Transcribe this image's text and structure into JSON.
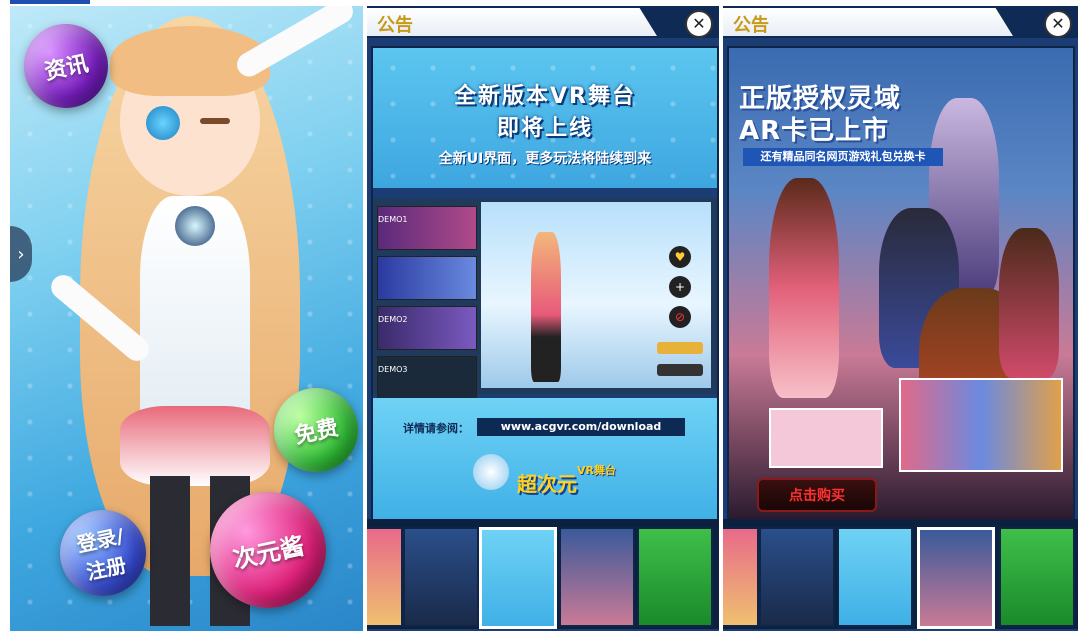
{
  "panel1": {
    "bubbles": {
      "news": "资讯",
      "free": "免费",
      "login_line1": "登录/",
      "login_line2": "注册",
      "ciyuanjiang": "次元酱"
    },
    "nav_arrow_icon": "chevron-right-icon"
  },
  "panel2": {
    "header_title": "公告",
    "close_icon": "close-icon",
    "headline_line1": "全新版本VR舞台",
    "headline_line2": "即将上线",
    "subline": "全新UI界面，更多玩法将陆续到来",
    "details_label": "详情请参阅：",
    "url": "www.acgvr.com/download",
    "logo_text_main": "超次元",
    "logo_text_sub": "VR舞台",
    "app_song_labels": [
      "DEMO1",
      "DEMO2",
      "DEMO3"
    ]
  },
  "panel3": {
    "header_title": "公告",
    "close_icon": "close-icon",
    "headline_line1": "正版授权灵域",
    "headline_line2": "AR卡已上市",
    "subline": "还有精品同名网页游戏礼包兑换卡",
    "buy_button": "点击购买"
  },
  "colors": {
    "header_gold": "#c79a1a",
    "panel_navy": "#1b3d74",
    "buy_red": "#ff3030"
  }
}
